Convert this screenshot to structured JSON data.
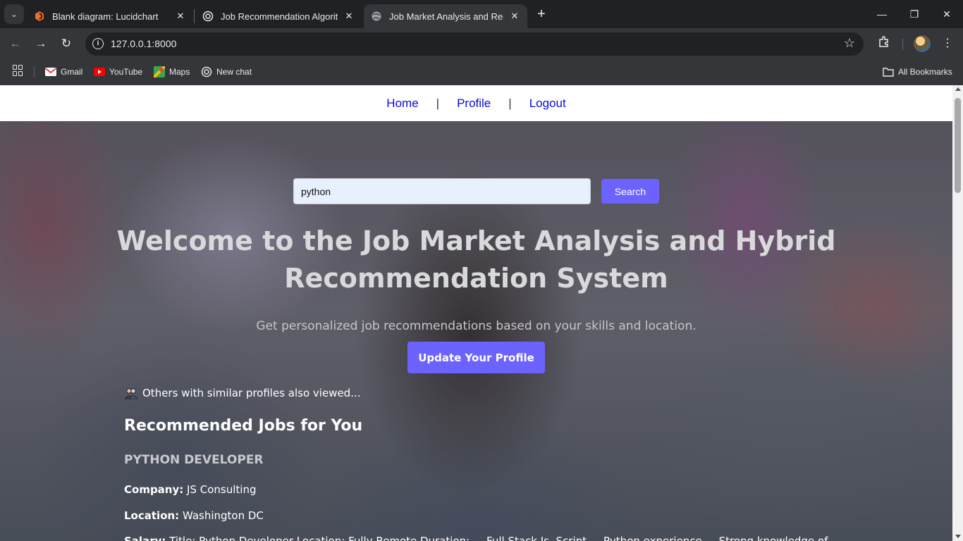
{
  "browser": {
    "tabs": [
      {
        "title": "Blank diagram: Lucidchart",
        "favicon": "lucidchart-icon",
        "active": false
      },
      {
        "title": "Job Recommendation Algorithm",
        "favicon": "openai-icon",
        "active": false
      },
      {
        "title": "Job Market Analysis and Recomm",
        "favicon": "globe-icon",
        "active": true
      }
    ],
    "url": "127.0.0.1:8000",
    "bookmarks": [
      {
        "label": "Gmail",
        "icon": "gmail-icon"
      },
      {
        "label": "YouTube",
        "icon": "youtube-icon"
      },
      {
        "label": "Maps",
        "icon": "maps-icon"
      },
      {
        "label": "New chat",
        "icon": "openai-icon"
      }
    ],
    "all_bookmarks_label": "All Bookmarks"
  },
  "nav": {
    "home": "Home",
    "profile": "Profile",
    "logout": "Logout",
    "separator": "|"
  },
  "search": {
    "value": "python",
    "button": "Search"
  },
  "hero": {
    "title_line1": "Welcome to the Job Market Analysis and Hybrid",
    "title_line2": "Recommendation System",
    "subtitle": "Get personalized job recommendations based on your skills and location.",
    "update_button": "Update Your Profile"
  },
  "similar": {
    "text": "Others with similar profiles also viewed..."
  },
  "recommendations": {
    "heading": "Recommended Jobs for You",
    "job": {
      "title": "PYTHON DEVELOPER",
      "company_label": "Company:",
      "company": "JS Consulting",
      "location_label": "Location:",
      "location": "Washington DC",
      "third_label": "Salary:",
      "third_value": "Title: Python Developer Location: Fully Remote Duration: ... Full Stack Js, Script ... Python experience ... Strong knowledge of"
    }
  },
  "colors": {
    "accent": "#6c63ff",
    "link": "#0b0bd6",
    "chrome_dark": "#202124",
    "chrome_toolbar": "#35363a"
  }
}
